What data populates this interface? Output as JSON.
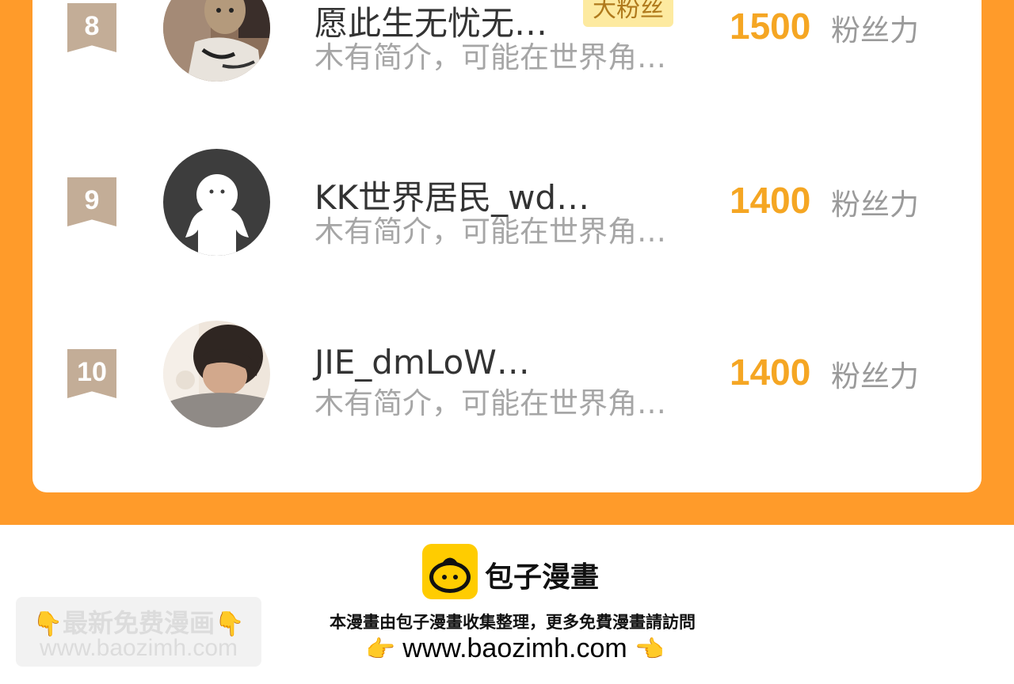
{
  "ranking": [
    {
      "rank": "8",
      "avatar": "cat-photo-avatar",
      "name": "愿此生无忧无…",
      "badge": "大粉丝",
      "intro": "木有简介，可能在世界角…",
      "score": "1500",
      "unit": "粉丝力"
    },
    {
      "rank": "9",
      "avatar": "default-avatar",
      "name": "KK世界居民_wd…",
      "badge": "",
      "intro": "木有简介，可能在世界角…",
      "score": "1400",
      "unit": "粉丝力"
    },
    {
      "rank": "10",
      "avatar": "person-photo-avatar",
      "name": "JIE_dmLoW…",
      "badge": "",
      "intro": "木有简介，可能在世界角…",
      "score": "1400",
      "unit": "粉丝力"
    }
  ],
  "footer": {
    "brand": "包子漫畫",
    "promo_title": "最新免费漫画",
    "promo_url": "www.baozimh.com",
    "note": "本漫畫由包子漫畫收集整理，更多免費漫畫請訪問",
    "url": "www.baozimh.com"
  },
  "colors": {
    "accent": "#ff9b2a",
    "score": "#f5a623",
    "rank_badge": "#c3ad97"
  }
}
